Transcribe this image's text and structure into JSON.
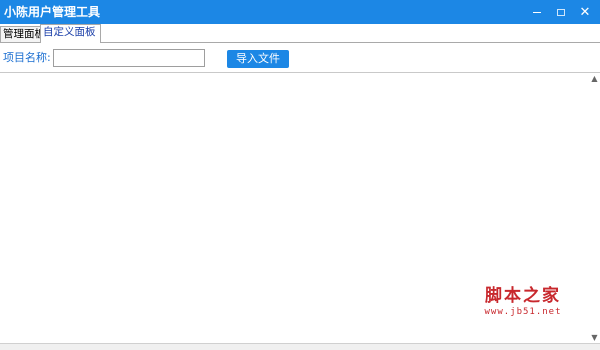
{
  "window": {
    "title": "小陈用户管理工具",
    "title_bar_color": "#1c87e5",
    "controls": {
      "minimize_icon": "minimize-icon",
      "maximize_icon": "maximize-icon",
      "close_icon": "close-icon",
      "close_glyph": "✕"
    }
  },
  "tabs": [
    {
      "label": "管理面板",
      "active": false
    },
    {
      "label": "自定义面板",
      "active": true
    }
  ],
  "form": {
    "project_name_label": "项目名称:",
    "project_name_value": "",
    "import_button_label": "导入文件"
  },
  "scrollbar": {
    "up_glyph": "▲",
    "down_glyph": "▼"
  },
  "watermark": {
    "text": "脚本之家",
    "url": "www.jb51.net"
  }
}
